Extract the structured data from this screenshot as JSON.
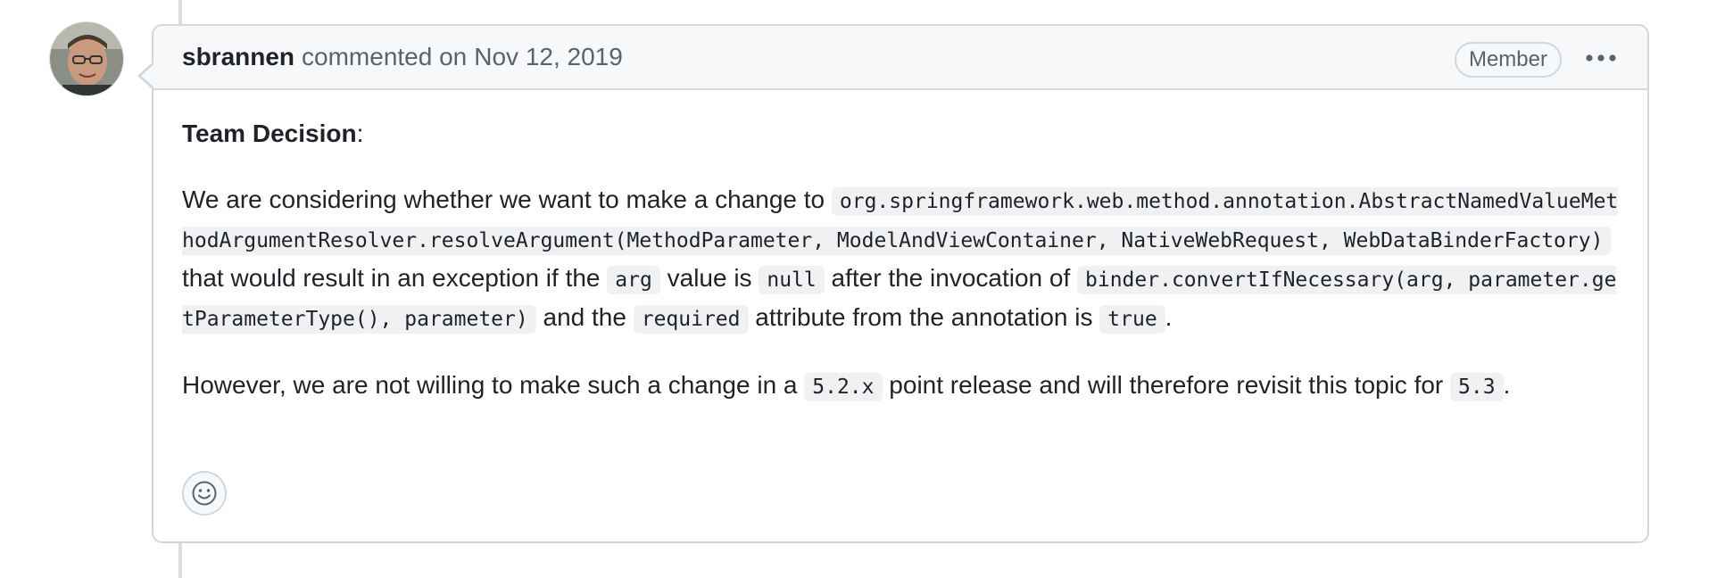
{
  "comment": {
    "author": "sbrannen",
    "action": "commented on",
    "date": "Nov 12, 2019",
    "badge": "Member",
    "avatar_icon": "user-avatar-photo",
    "more_icon": "kebab-horizontal-icon",
    "reaction_icon": "smiley-icon"
  },
  "body": {
    "decision_label": "Team Decision",
    "decision_suffix": ":",
    "p1_text1": "We are considering whether we want to make a change to ",
    "p1_code1": "org.springframework.web.method.annotation.AbstractNamedValueMethodArgumentResolver.resolveArgument(MethodParameter, ModelAndViewContainer, NativeWebRequest, WebDataBinderFactory)",
    "p1_text2": " that would result in an exception if the ",
    "p1_code2": "arg",
    "p1_text3": " value is ",
    "p1_code3": "null",
    "p1_text4": " after the invocation of ",
    "p1_code4": "binder.convertIfNecessary(arg, parameter.getParameterType(), parameter)",
    "p1_text5": " and the ",
    "p1_code5": "required",
    "p1_text6": " attribute from the annotation is ",
    "p1_code6": "true",
    "p1_text7": ".",
    "p2_text1": "However, we are not willing to make such a change in a ",
    "p2_code1": "5.2.x",
    "p2_text2": " point release and will therefore revisit this topic for ",
    "p2_code2": "5.3",
    "p2_text3": "."
  },
  "colors": {
    "border": "#d0d7de",
    "header_bg": "#f6f8fa",
    "muted_text": "#59636e",
    "code_bg": "#eff1f3"
  }
}
